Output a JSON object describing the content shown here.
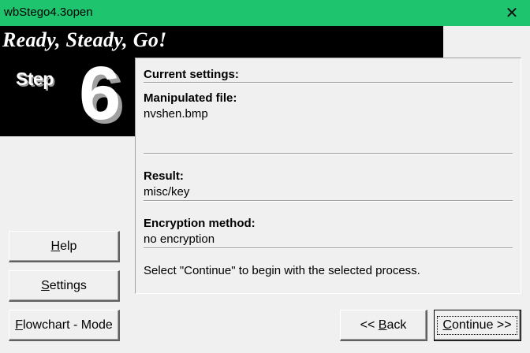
{
  "window": {
    "title": "wbStego4.3open",
    "close_glyph": "✕"
  },
  "banner": {
    "title": "Ready, Steady, Go!"
  },
  "step": {
    "word": "Step",
    "number": "6"
  },
  "panel": {
    "current_settings_label": "Current settings:",
    "manipulated_file_label": "Manipulated file:",
    "manipulated_file_value": "nvshen.bmp",
    "result_label": "Result:",
    "result_value": "misc/key",
    "encryption_label": "Encryption method:",
    "encryption_value": "no encryption",
    "instruction": "Select \"Continue\" to begin with the selected process."
  },
  "buttons": {
    "help": {
      "mnemonic": "H",
      "rest": "elp"
    },
    "settings": {
      "mnemonic": "S",
      "rest": "ettings"
    },
    "flowchart": {
      "mnemonic": "F",
      "rest": "lowchart - Mode"
    },
    "back": {
      "prefix": "<< ",
      "mnemonic": "B",
      "rest": "ack"
    },
    "continue": {
      "mnemonic": "C",
      "rest": "ontinue >>"
    }
  }
}
